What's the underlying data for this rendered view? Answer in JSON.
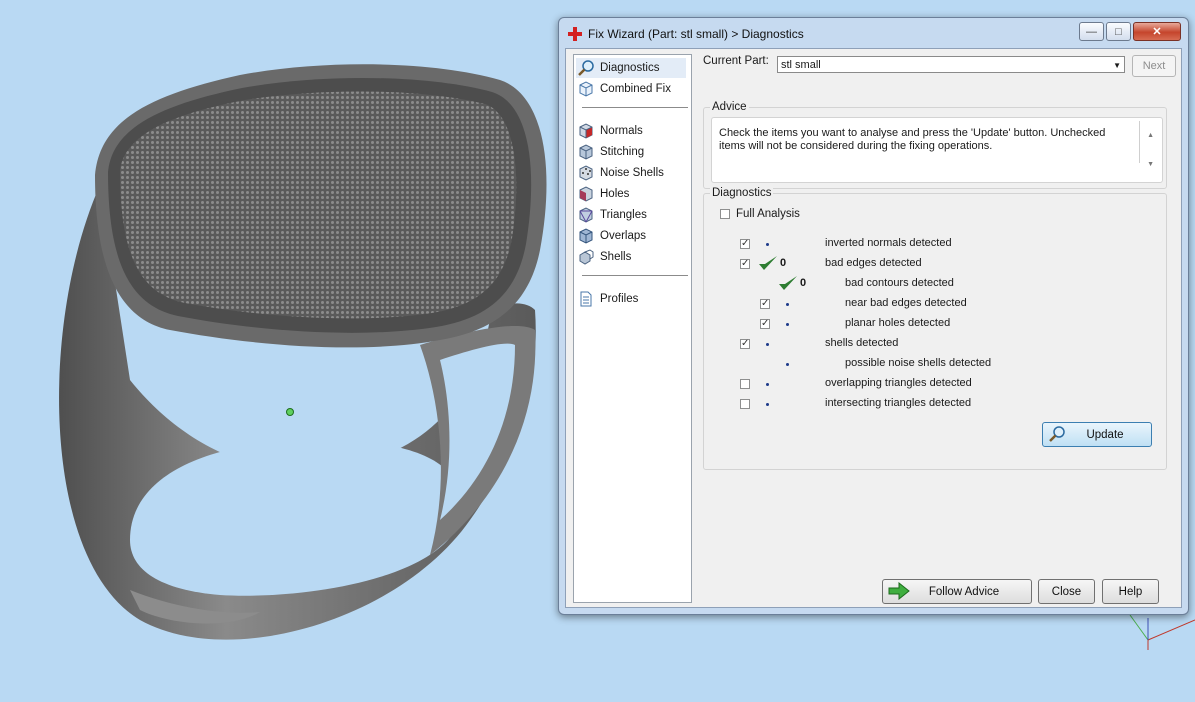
{
  "window": {
    "title": "Fix Wizard (Part: stl small) > Diagnostics"
  },
  "nav": {
    "items": [
      {
        "label": "Diagnostics",
        "icon": "magnifier-icon"
      },
      {
        "label": "Combined Fix",
        "icon": "cube-outline-icon"
      },
      {
        "label": "Normals",
        "icon": "red-cube-icon"
      },
      {
        "label": "Stitching",
        "icon": "cube-icon"
      },
      {
        "label": "Noise Shells",
        "icon": "dotted-cube-icon"
      },
      {
        "label": "Holes",
        "icon": "cube-hole-icon"
      },
      {
        "label": "Triangles",
        "icon": "triangle-cube-icon"
      },
      {
        "label": "Overlaps",
        "icon": "blue-cube-icon"
      },
      {
        "label": "Shells",
        "icon": "cubes-icon"
      },
      {
        "label": "Profiles",
        "icon": "document-icon"
      }
    ],
    "selected": "Diagnostics"
  },
  "current_part": {
    "label": "Current Part:",
    "value": "stl small"
  },
  "next_label": "Next",
  "advice": {
    "title": "Advice",
    "text": "Check the items you want to analyse and press the 'Update' button. Unchecked items will not be considered during the fixing operations."
  },
  "diagnostics": {
    "title": "Diagnostics",
    "full_analysis": {
      "label": "Full Analysis",
      "checked": false
    },
    "rows": [
      {
        "label": "inverted normals detected",
        "checked": true,
        "status": "pending",
        "count": ""
      },
      {
        "label": "bad edges detected",
        "checked": true,
        "status": "ok",
        "count": "0"
      },
      {
        "label": "bad contours detected",
        "checked": null,
        "status": "ok",
        "count": "0"
      },
      {
        "label": "near bad edges detected",
        "checked": true,
        "status": "pending",
        "count": ""
      },
      {
        "label": "planar holes detected",
        "checked": true,
        "status": "pending",
        "count": ""
      },
      {
        "label": "shells detected",
        "checked": true,
        "status": "pending",
        "count": ""
      },
      {
        "label": "possible noise shells detected",
        "checked": null,
        "status": "pending",
        "count": ""
      },
      {
        "label": "overlapping triangles detected",
        "checked": false,
        "status": "pending",
        "count": ""
      },
      {
        "label": "intersecting triangles detected",
        "checked": false,
        "status": "pending",
        "count": ""
      }
    ],
    "update_label": "Update"
  },
  "footer": {
    "follow_advice_label": "Follow Advice",
    "close_label": "Close",
    "help_label": "Help"
  },
  "colors": {
    "background": "#b9d9f3",
    "ring": "#6e6e6e",
    "check": "#2e7d32",
    "accent": "#3c7fb1"
  }
}
